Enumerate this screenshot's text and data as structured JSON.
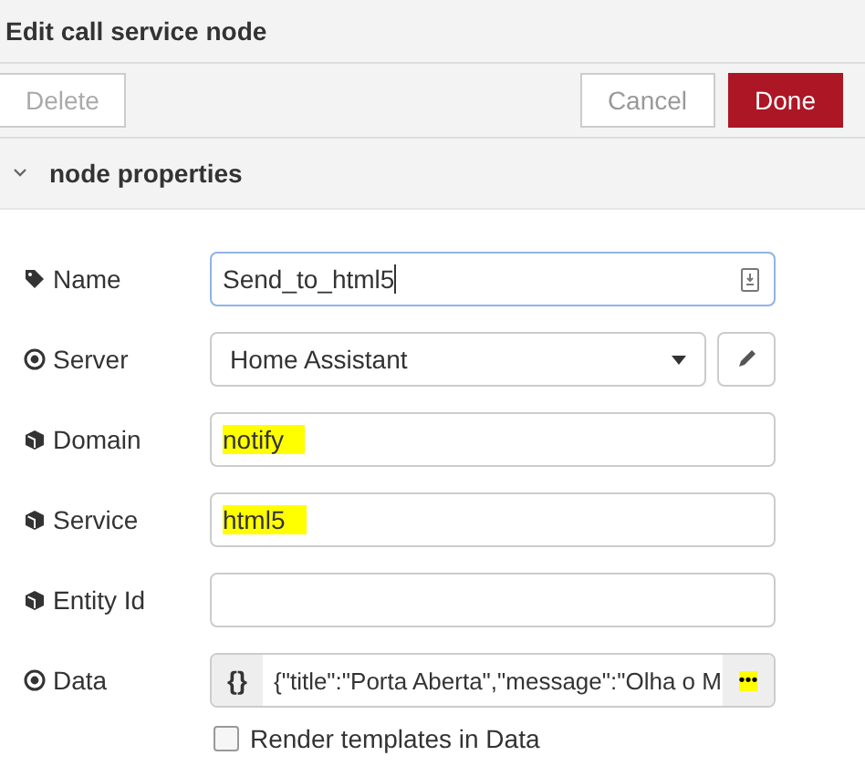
{
  "dialog": {
    "title": "Edit call service node"
  },
  "buttons": [
    {
      "label": "Delete",
      "kind": "disabled"
    },
    {
      "label": "Cancel",
      "kind": "plain"
    },
    {
      "label": "Done",
      "kind": "primary"
    }
  ],
  "section": {
    "title": "node properties",
    "expanded": true
  },
  "fields": [
    {
      "label": "Name",
      "kind": "text",
      "value": "Send_to_html5",
      "focused": true
    },
    {
      "label": "Server",
      "kind": "select",
      "value": "Home Assistant"
    },
    {
      "label": "Domain",
      "kind": "text",
      "value": "notify",
      "highlighted": true
    },
    {
      "label": "Service",
      "kind": "text",
      "value": "html5",
      "highlighted": true
    },
    {
      "label": "Entity Id",
      "kind": "text"
    },
    {
      "label": "Data",
      "kind": "json",
      "type_label": "{}",
      "value": "{\"title\":\"Porta Aberta\",\"message\":\"Olha o M",
      "expand_label": "•••",
      "expand_highlighted": true
    }
  ],
  "checkbox": {
    "label": "Render templates in Data",
    "checked": false
  }
}
